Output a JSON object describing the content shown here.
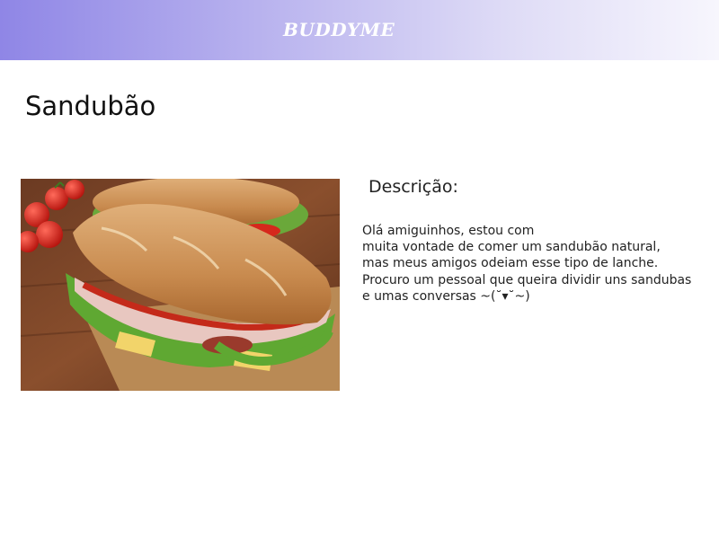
{
  "header": {
    "brand": "BUDDYME"
  },
  "page": {
    "title": "Sandubão"
  },
  "post": {
    "image_icon": "sandwich-photo",
    "description_label": "Descrição:",
    "description_lines": [
      "Olá amiguinhos, estou com",
      "muita vontade de comer um sandubão natural,",
      "mas meus amigos odeiam esse tipo de lanche.",
      "Procuro um pessoal que queira dividir uns sandubas",
      "e umas conversas ~(˘▾˘~)"
    ]
  },
  "colors": {
    "header_gradient_start": "#8f86e6",
    "header_gradient_end": "#f7f6fd",
    "text": "#222222"
  }
}
